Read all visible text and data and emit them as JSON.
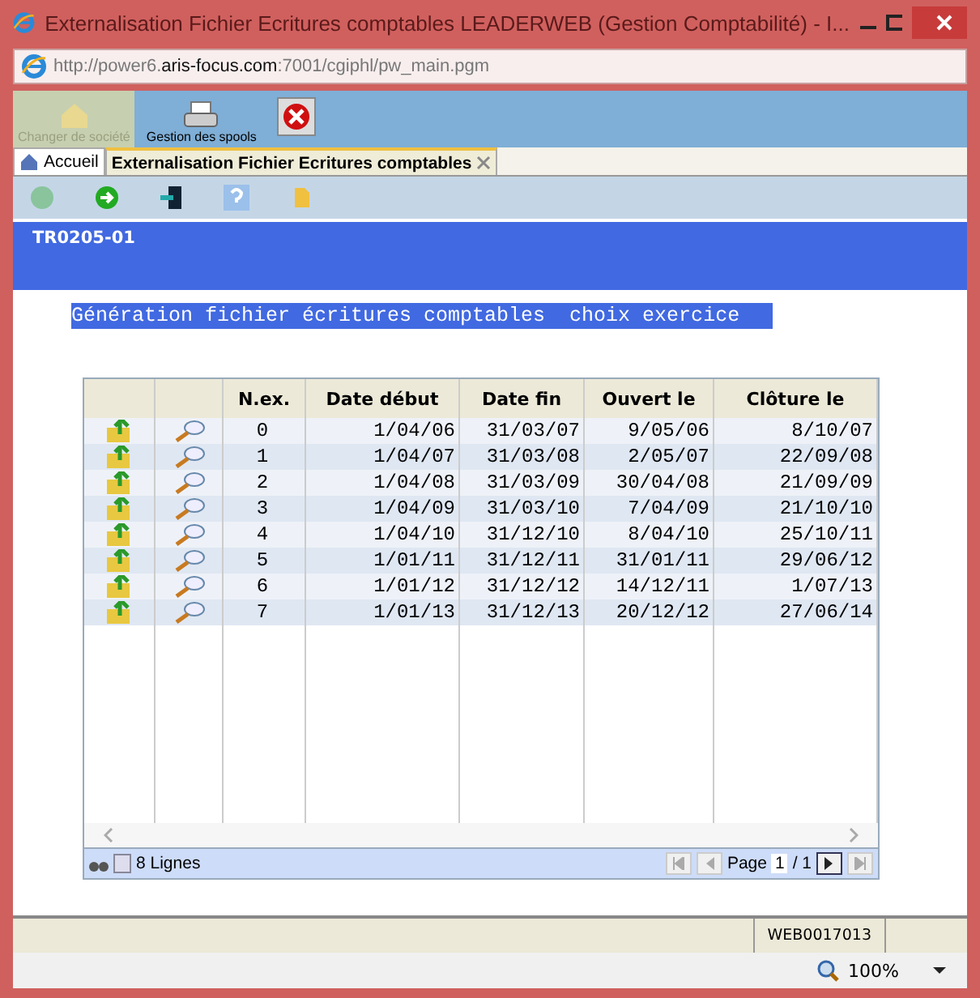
{
  "window": {
    "title": "Externalisation Fichier Ecritures comptables LEADERWEB (Gestion Comptabilité) - I..."
  },
  "address": {
    "prefix": "http://power6.",
    "domain": "aris-focus.com",
    "suffix": ":7001/cgiphl/pw_main.pgm"
  },
  "toolbar": [
    {
      "kind": "house",
      "label": "Changer de société",
      "disabled": true
    },
    {
      "kind": "printer",
      "label": "Gestion des spools",
      "disabled": false
    },
    {
      "kind": "stop",
      "disabled": false
    }
  ],
  "tabs": [
    {
      "kind": "home",
      "label": "Accueil",
      "selected": false
    },
    {
      "kind": "page",
      "label": "Externalisation Fichier Ecritures comptables",
      "selected": true
    }
  ],
  "actions": [
    {
      "kind": "back",
      "disabled": true
    },
    {
      "kind": "forward",
      "disabled": false
    },
    {
      "kind": "exit",
      "disabled": false
    },
    {
      "kind": "help",
      "disabled": false
    },
    {
      "kind": "doc",
      "disabled": false
    }
  ],
  "header": {
    "code": "TR0205-01"
  },
  "heading": "Génération fichier écritures comptables  choix exercice",
  "table": {
    "columns": [
      "N.ex.",
      "Date début",
      "Date fin",
      "Ouvert le",
      "Clôture le"
    ],
    "rows": [
      [
        "0",
        "1/04/06",
        "31/03/07",
        "9/05/06",
        "8/10/07"
      ],
      [
        "1",
        "1/04/07",
        "31/03/08",
        "2/05/07",
        "22/09/08"
      ],
      [
        "2",
        "1/04/08",
        "31/03/09",
        "30/04/08",
        "21/09/09"
      ],
      [
        "3",
        "1/04/09",
        "31/03/10",
        "7/04/09",
        "21/10/10"
      ],
      [
        "4",
        "1/04/10",
        "31/12/10",
        "8/04/10",
        "25/10/11"
      ],
      [
        "5",
        "1/01/11",
        "31/12/11",
        "31/01/11",
        "29/06/12"
      ],
      [
        "6",
        "1/01/12",
        "31/12/12",
        "14/12/11",
        "1/07/13"
      ],
      [
        "7",
        "1/01/13",
        "31/12/13",
        "20/12/12",
        "27/06/14"
      ]
    ],
    "count": "8 Lignes",
    "page_label": "Page",
    "page": "1",
    "page_total": "/ 1"
  },
  "status_bar": {
    "code": "WEB0017013"
  },
  "zoom": "100%"
}
